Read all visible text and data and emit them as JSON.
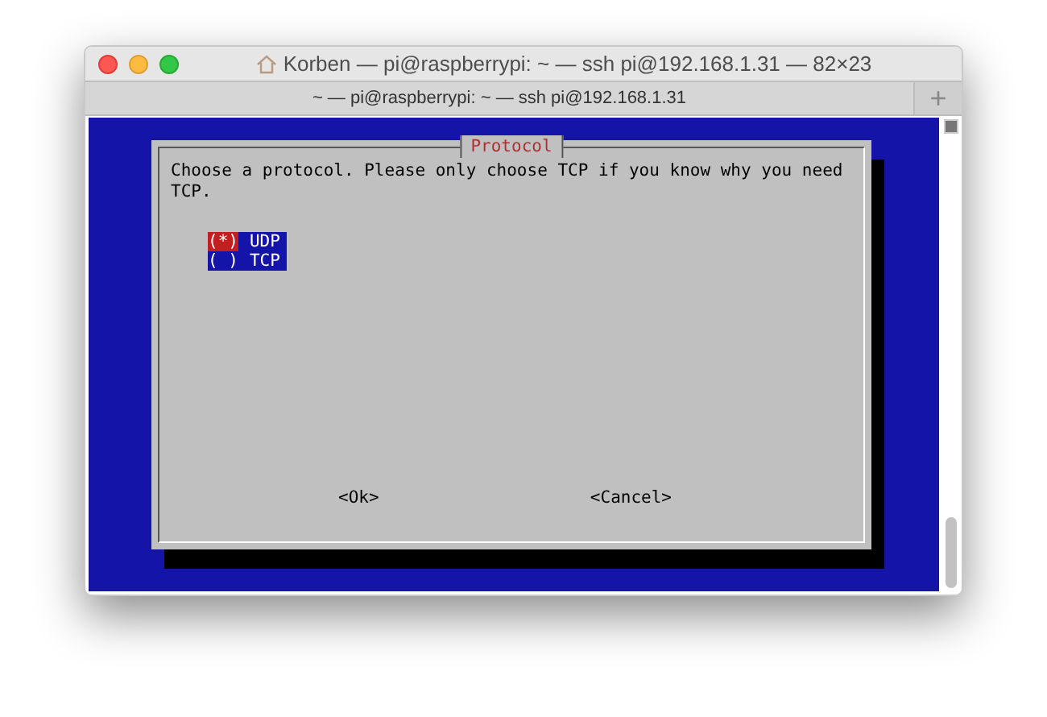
{
  "window": {
    "title": "Korben — pi@raspberrypi: ~ — ssh pi@192.168.1.31 — 82×23",
    "tab": "~ — pi@raspberrypi: ~ — ssh pi@192.168.1.31",
    "new_tab": "+"
  },
  "dialog": {
    "title": "Protocol",
    "message": "Choose a protocol. Please only choose TCP if you know why you need TCP.",
    "options": [
      {
        "marker": "(*)",
        "label": "UDP",
        "checked": true
      },
      {
        "marker": "( )",
        "label": "TCP",
        "checked": false
      }
    ],
    "buttons": [
      {
        "label": "<Ok>"
      },
      {
        "label": "<Cancel>"
      }
    ]
  }
}
